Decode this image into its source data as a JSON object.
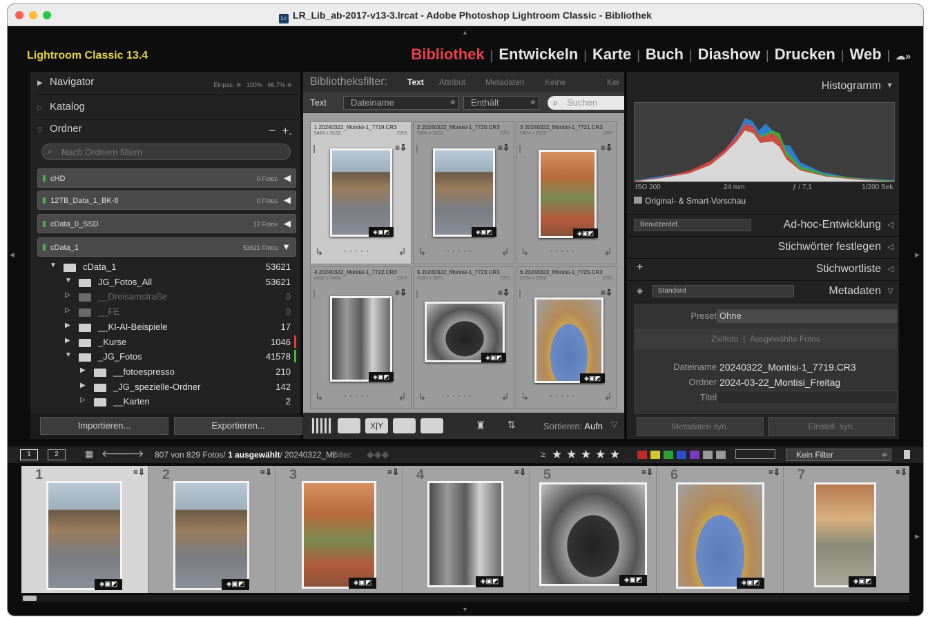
{
  "window": {
    "title": "LR_Lib_ab-2017-v13-3.lrcat - Adobe Photoshop Lightroom Classic - Bibliothek",
    "traffic_colors": [
      "#fe5f57",
      "#febc2e",
      "#28c840"
    ]
  },
  "identity_plate": "Lightroom Classic 13.4",
  "modules": {
    "items": [
      "Bibliothek",
      "Entwickeln",
      "Karte",
      "Buch",
      "Diashow",
      "Drucken",
      "Web"
    ],
    "active": "Bibliothek",
    "active_color": "#e8404c",
    "cloud_icon": "cloud-sync-icon"
  },
  "left_panel": {
    "navigator": {
      "label": "Navigator",
      "fit": "Einpas. ≑",
      "zoom1": "100%",
      "zoom2": "66.7% ≑"
    },
    "catalog": {
      "label": "Katalog"
    },
    "folders": {
      "label": "Ordner",
      "minus": "−",
      "plus": "+.",
      "search_placeholder": "Nach Ordnern filtern"
    },
    "volumes": [
      {
        "name": "cHD",
        "count": "0 Fotos",
        "arrow": "◀"
      },
      {
        "name": "12TB_Data_1_BK-8",
        "count": "0 Fotos",
        "arrow": "◀"
      },
      {
        "name": "cData_0_SSD",
        "count": "17 Fotos",
        "arrow": "◀"
      },
      {
        "name": "cData_1",
        "count": "53621 Fotos",
        "arrow": "▼"
      }
    ],
    "tree": [
      {
        "name": "cData_1",
        "count": "53621",
        "tri": "▼",
        "dim": false
      },
      {
        "name": "JG_Fotos_All",
        "count": "53621",
        "tri": "▼",
        "dim": false
      },
      {
        "name": "__Dreisamstraße",
        "count": "0",
        "tri": "▷",
        "dim": true
      },
      {
        "name": "__FE",
        "count": "0",
        "tri": "▷",
        "dim": true
      },
      {
        "name": "__KI-AI-Beispiele",
        "count": "17",
        "tri": "▶",
        "dim": false
      },
      {
        "name": "_Kurse",
        "count": "1046",
        "tri": "▶",
        "dim": false,
        "mark": "#e0403c"
      },
      {
        "name": "_JG_Fotos",
        "count": "41578",
        "tri": "▼",
        "dim": false,
        "mark": "#3cbf3c"
      },
      {
        "name": "__fotoespresso",
        "count": "210",
        "tri": "▶",
        "dim": false
      },
      {
        "name": "_JG_spezielle-Ordner",
        "count": "142",
        "tri": "▶",
        "dim": false
      },
      {
        "name": "__Karten",
        "count": "2",
        "tri": "▷",
        "dim": false
      }
    ],
    "buttons": {
      "import": "Importieren...",
      "export": "Exportieren..."
    }
  },
  "library_filter": {
    "label": "Bibliotheksfilter:",
    "tabs": [
      "Text",
      "Attribut",
      "Metadaten",
      "Keine"
    ],
    "preset_label": "Kei",
    "text_label": "Text",
    "field": "Dateiname",
    "rule": "Enthält",
    "search_placeholder": "Suchen"
  },
  "grid": [
    {
      "idx": "1  20240322_Montisi-1_7719.CR3",
      "dim": "5464 x 8192",
      "ext": "CR3",
      "selected": true,
      "tone": "street"
    },
    {
      "idx": "2  20240322_Montisi-1_7720.CR3",
      "dim": "5464 x 8192",
      "ext": "CR3",
      "selected": false,
      "tone": "street"
    },
    {
      "idx": "3  20240322_Montisi-1_7721.CR3",
      "dim": "5464 x 8192",
      "ext": "CR3",
      "selected": false,
      "tone": "stairs"
    },
    {
      "idx": "4  20240322_Montisi-1_7722.CR3",
      "dim": "4842 x 6404",
      "ext": "CR3",
      "selected": false,
      "tone": "wood"
    },
    {
      "idx": "5  20240322_Montisi-1_7723.CR3",
      "dim": "5184 x 3891",
      "ext": "CR3",
      "selected": false,
      "tone": "window"
    },
    {
      "idx": "6  20240322_Montisi-1_7725.CR3",
      "dim": "5284 x 6360",
      "ext": "CR3",
      "selected": false,
      "tone": "door"
    }
  ],
  "toolbar": {
    "sort_label": "Sortieren:",
    "sort_value": "Aufn"
  },
  "right_panel": {
    "histogram": {
      "label": "Histogramm"
    },
    "exif": {
      "iso": "ISO 200",
      "focal": "24 mm",
      "aperture": "ƒ / 7,1",
      "shutter": "1/200 Sek."
    },
    "preview": "Original- & Smart-Vorschau",
    "quick_develop": {
      "label": "Ad-hoc-Entwicklung",
      "preset": "Benutzerdef."
    },
    "keywording": {
      "label": "Stichwörter festlegen"
    },
    "keyword_list": {
      "label": "Stichwortliste",
      "plus": "+"
    },
    "metadata": {
      "label": "Metadaten",
      "preset_dropdown": "Standard",
      "preset_label": "Preset",
      "preset_value": "Ohne",
      "target_photo": "Zielfoto",
      "selected_photos": "Ausgewählte Fotos",
      "filename_label": "Dateiname",
      "filename": "20240322_Montisi-1_7719.CR3",
      "folder_label": "Ordner",
      "folder": "2024-03-22_Montisi_Freitag",
      "title_label": "Titel"
    },
    "buttons": {
      "sync_meta": "Metadaten syn.",
      "sync_settings": "Einstell. syn."
    }
  },
  "filmstrip_bar": {
    "page1": "1",
    "page2": "2",
    "count_text": "807 von 829 Fotos/ ",
    "selected_text": "1 ausgewählt",
    "file_text": "/ 20240322_Mc",
    "filter_label": "Filter:",
    "rating_prefix": "≥",
    "stars": 5,
    "color_labels": [
      "#c0282a",
      "#d6c82a",
      "#2ea23a",
      "#2a4fd0",
      "#7a3ac0",
      "#999999",
      "#999999"
    ],
    "filter_preset": "Kein Filter"
  },
  "filmstrip": [
    {
      "num": "1",
      "tone": "street",
      "selected": true
    },
    {
      "num": "2",
      "tone": "street",
      "selected": false
    },
    {
      "num": "3",
      "tone": "stairs",
      "selected": false
    },
    {
      "num": "4",
      "tone": "wood",
      "selected": false
    },
    {
      "num": "5",
      "tone": "window",
      "selected": false
    },
    {
      "num": "6",
      "tone": "door",
      "selected": false
    },
    {
      "num": "7",
      "tone": "arch",
      "selected": false
    }
  ]
}
